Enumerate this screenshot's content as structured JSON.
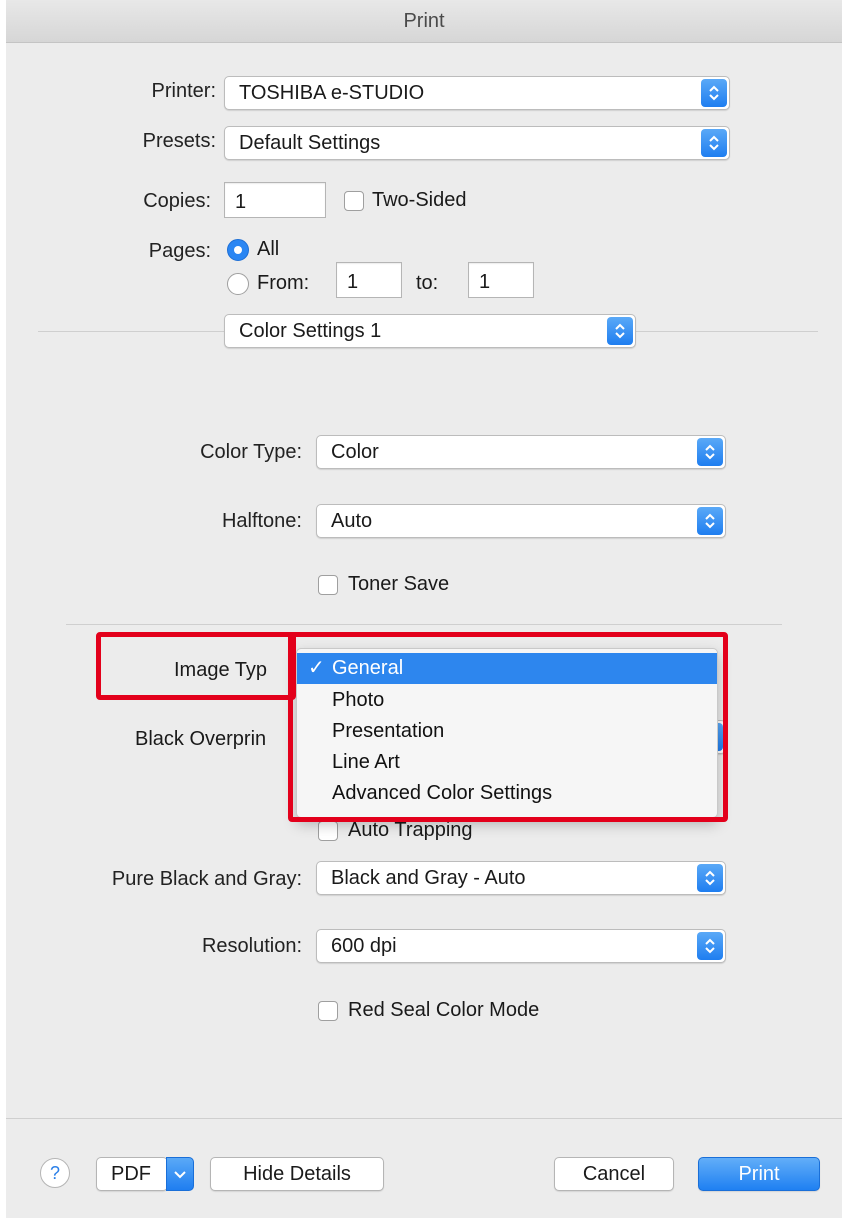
{
  "window": {
    "title": "Print"
  },
  "printer": {
    "label": "Printer:",
    "value": "TOSHIBA e-STUDIO"
  },
  "presets": {
    "label": "Presets:",
    "value": "Default Settings"
  },
  "copies": {
    "label": "Copies:",
    "value": "1",
    "two_sided_label": "Two-Sided",
    "two_sided_checked": false
  },
  "pages": {
    "label": "Pages:",
    "all_label": "All",
    "all_selected": true,
    "from_label": "From:",
    "from_value": "1",
    "to_label": "to:",
    "to_value": "1"
  },
  "panel": {
    "value": "Color Settings 1"
  },
  "color_type": {
    "label": "Color Type:",
    "value": "Color"
  },
  "halftone": {
    "label": "Halftone:",
    "value": "Auto"
  },
  "toner_save": {
    "label": "Toner Save",
    "checked": false
  },
  "image_type": {
    "label": "Image Type:",
    "label_visible": "Image Typ",
    "options": [
      "General",
      "Photo",
      "Presentation",
      "Line Art",
      "Advanced Color Settings"
    ],
    "selected": "General",
    "check_glyph": "✓"
  },
  "black_overprint": {
    "label_visible": "Black Overprin"
  },
  "auto_trapping": {
    "label": "Auto Trapping",
    "checked": false
  },
  "pure_black_gray": {
    "label": "Pure Black and Gray:",
    "value": "Black and Gray - Auto"
  },
  "resolution": {
    "label": "Resolution:",
    "value": "600 dpi"
  },
  "red_seal": {
    "label": "Red Seal Color Mode",
    "checked": false
  },
  "footer": {
    "help": "?",
    "pdf": "PDF",
    "hide_details": "Hide Details",
    "cancel": "Cancel",
    "print": "Print"
  },
  "colors": {
    "accent": "#2d86ee",
    "highlight_box": "#e3001b"
  }
}
